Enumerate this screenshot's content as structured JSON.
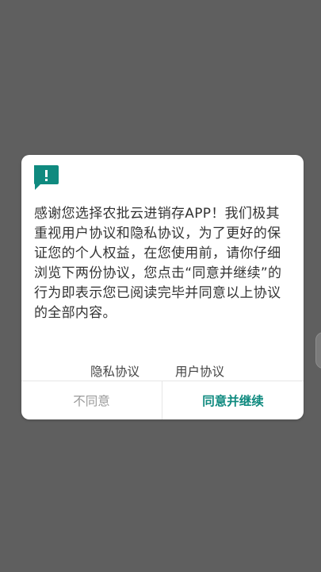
{
  "dialog": {
    "icon": "alert-bubble-icon",
    "accent_color": "#0f8a7f",
    "message": "感谢您选择农批云进销存APP！我们极其重视用户协议和隐私协议，为了更好的保证您的个人权益，在您使用前，请你仔细浏览下两份协议，您点击“同意并继续”的行为即表示您已阅读完毕并同意以上协议的全部内容。",
    "links": {
      "privacy": "隐私协议",
      "user": "用户协议"
    },
    "buttons": {
      "disagree": "不同意",
      "agree": "同意并继续"
    }
  }
}
